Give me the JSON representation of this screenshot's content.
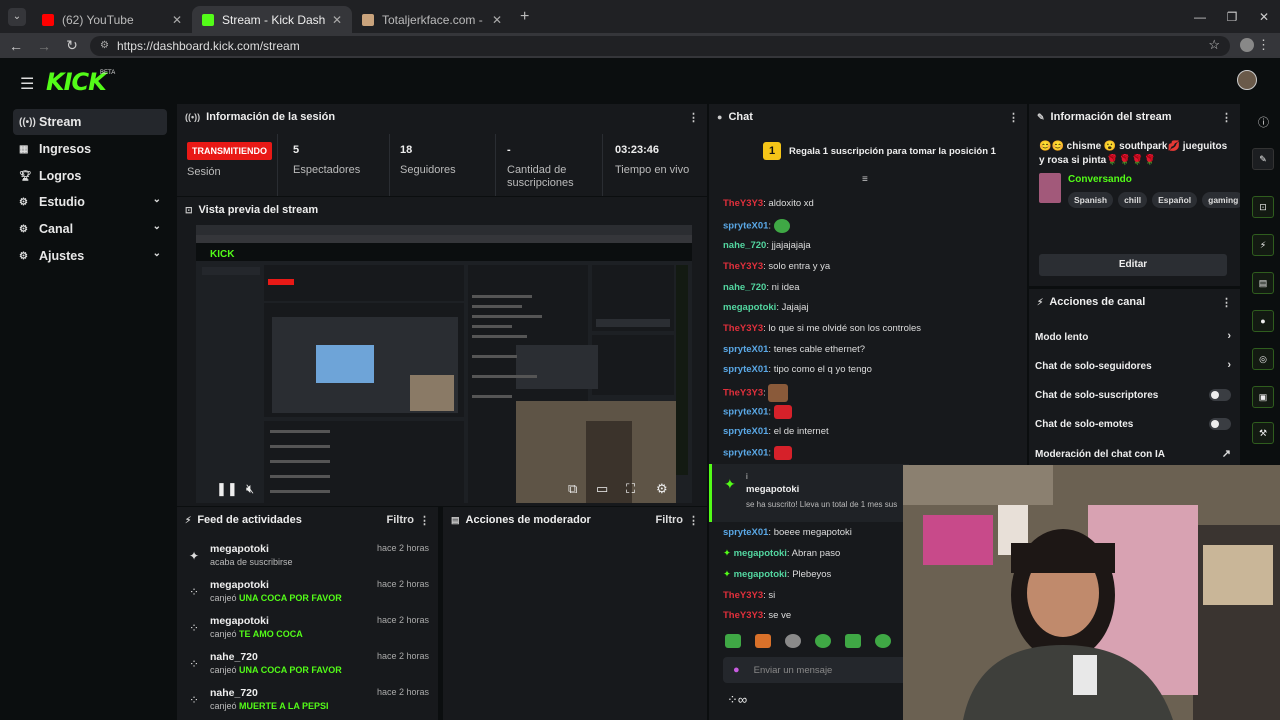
{
  "browser": {
    "tabs": [
      {
        "title": "(62) YouTube",
        "color": "#ff0000"
      },
      {
        "title": "Stream - Kick Dashboard",
        "color": "#53fc18"
      },
      {
        "title": "Totaljerkface.com - Home Of H",
        "color": "#c9a37c"
      }
    ],
    "url": "https://dashboard.kick.com/stream"
  },
  "app": {
    "logo": "KICK",
    "beta": "BETA"
  },
  "sidebar": {
    "items": [
      {
        "label": "Stream",
        "icon": "broadcast-icon"
      },
      {
        "label": "Ingresos",
        "icon": "money-icon"
      },
      {
        "label": "Logros",
        "icon": "trophy-icon"
      },
      {
        "label": "Estudio",
        "icon": "gear-icon"
      },
      {
        "label": "Canal",
        "icon": "gear-icon"
      },
      {
        "label": "Ajustes",
        "icon": "gear-icon"
      }
    ]
  },
  "session": {
    "title": "Información de la sesión",
    "status": "TRANSMITIENDO",
    "status_label": "Sesión",
    "viewers": "5",
    "viewers_label": "Espectadores",
    "followers": "18",
    "followers_label": "Seguidores",
    "subs": "-",
    "subs_label": "Cantidad de suscripciones",
    "live_time": "03:23:46",
    "live_label": "Tiempo en vivo"
  },
  "preview": {
    "title": "Vista previa del stream"
  },
  "activity": {
    "title": "Feed de actividades",
    "filter": "Filtro",
    "items": [
      {
        "user": "megapotoki",
        "verb": "acaba de suscribirse",
        "reward": "",
        "time": "hace 2 horas"
      },
      {
        "user": "megapotoki",
        "verb": "canjeó",
        "reward": "UNA COCA POR FAVOR",
        "time": "hace 2 horas"
      },
      {
        "user": "megapotoki",
        "verb": "canjeó",
        "reward": "TE AMO COCA",
        "time": "hace 2 horas"
      },
      {
        "user": "nahe_720",
        "verb": "canjeó",
        "reward": "UNA COCA POR FAVOR",
        "time": "hace 2 horas"
      },
      {
        "user": "nahe_720",
        "verb": "canjeó",
        "reward": "MUERTE A LA PEPSI",
        "time": "hace 2 horas"
      }
    ]
  },
  "moderator": {
    "title": "Acciones de moderador",
    "filter": "Filtro"
  },
  "chat": {
    "title": "Chat",
    "gift_banner": "Regala 1 suscripción para tomar la posición 1",
    "gift_rank": "1",
    "messages": [
      {
        "user": "TheY3Y3",
        "text": ": aldoxito xd",
        "color": "#e0303c"
      },
      {
        "user": "spryteX01",
        "text": ":",
        "color": "#5aa8e6"
      },
      {
        "user": "nahe_720",
        "text": ": jjajajajaja",
        "color": "#53d6a0"
      },
      {
        "user": "TheY3Y3",
        "text": ": solo entra y ya",
        "color": "#e0303c"
      },
      {
        "user": "nahe_720",
        "text": ": ni idea",
        "color": "#53d6a0"
      },
      {
        "user": "megapotoki",
        "text": ": Jajajaj",
        "color": "#53d6a0"
      },
      {
        "user": "TheY3Y3",
        "text": ": lo que si me olvidé son los controles",
        "color": "#e0303c"
      },
      {
        "user": "spryteX01",
        "text": ": tenes cable ethernet?",
        "color": "#5aa8e6"
      },
      {
        "user": "spryteX01",
        "text": ": tipo como el q yo tengo",
        "color": "#5aa8e6"
      },
      {
        "user": "TheY3Y3",
        "text": ":",
        "color": "#e0303c"
      },
      {
        "user": "spryteX01",
        "text": ":",
        "color": "#5aa8e6"
      },
      {
        "user": "spryteX01",
        "text": ": el de internet",
        "color": "#5aa8e6"
      },
      {
        "user": "spryteX01",
        "text": ":",
        "color": "#5aa8e6"
      }
    ],
    "sub_notice": {
      "prefix": "i",
      "user": "megapotoki",
      "text": "se ha suscrito! Lleva un total de 1 mes sus"
    },
    "messages2": [
      {
        "user": "spryteX01",
        "text": ": boeee megapotoki",
        "color": "#5aa8e6",
        "badge": false
      },
      {
        "user": "megapotoki",
        "text": ": Abran paso",
        "color": "#53d6a0",
        "badge": true
      },
      {
        "user": "megapotoki",
        "text": ": Plebeyos",
        "color": "#53d6a0",
        "badge": true
      },
      {
        "user": "TheY3Y3",
        "text": ": si",
        "color": "#e0303c",
        "badge": false
      },
      {
        "user": "TheY3Y3",
        "text": ": se ve",
        "color": "#e0303c",
        "badge": false
      }
    ],
    "input_placeholder": "Enviar un mensaje",
    "infinity": "∞"
  },
  "stream_info": {
    "title": "Información del stream",
    "stream_title": "😊😊 chisme 😮 southpark💋 jueguitos y rosa si pinta🌹🌹🌹🌹",
    "category": "Conversando",
    "tags": [
      "Spanish",
      "chill",
      "Español",
      "gaming"
    ],
    "edit_label": "Editar"
  },
  "channel_actions": {
    "title": "Acciones de canal",
    "rows": [
      {
        "label": "Modo lento",
        "kind": "chevron"
      },
      {
        "label": "Chat de solo-seguidores",
        "kind": "chevron"
      },
      {
        "label": "Chat de solo-suscriptores",
        "kind": "toggle"
      },
      {
        "label": "Chat de solo-emotes",
        "kind": "toggle"
      },
      {
        "label": "Moderación del chat con IA",
        "kind": "external"
      }
    ]
  },
  "colors": {
    "accent": "#53fc18",
    "live": "#e91916",
    "panel": "#17191c"
  }
}
